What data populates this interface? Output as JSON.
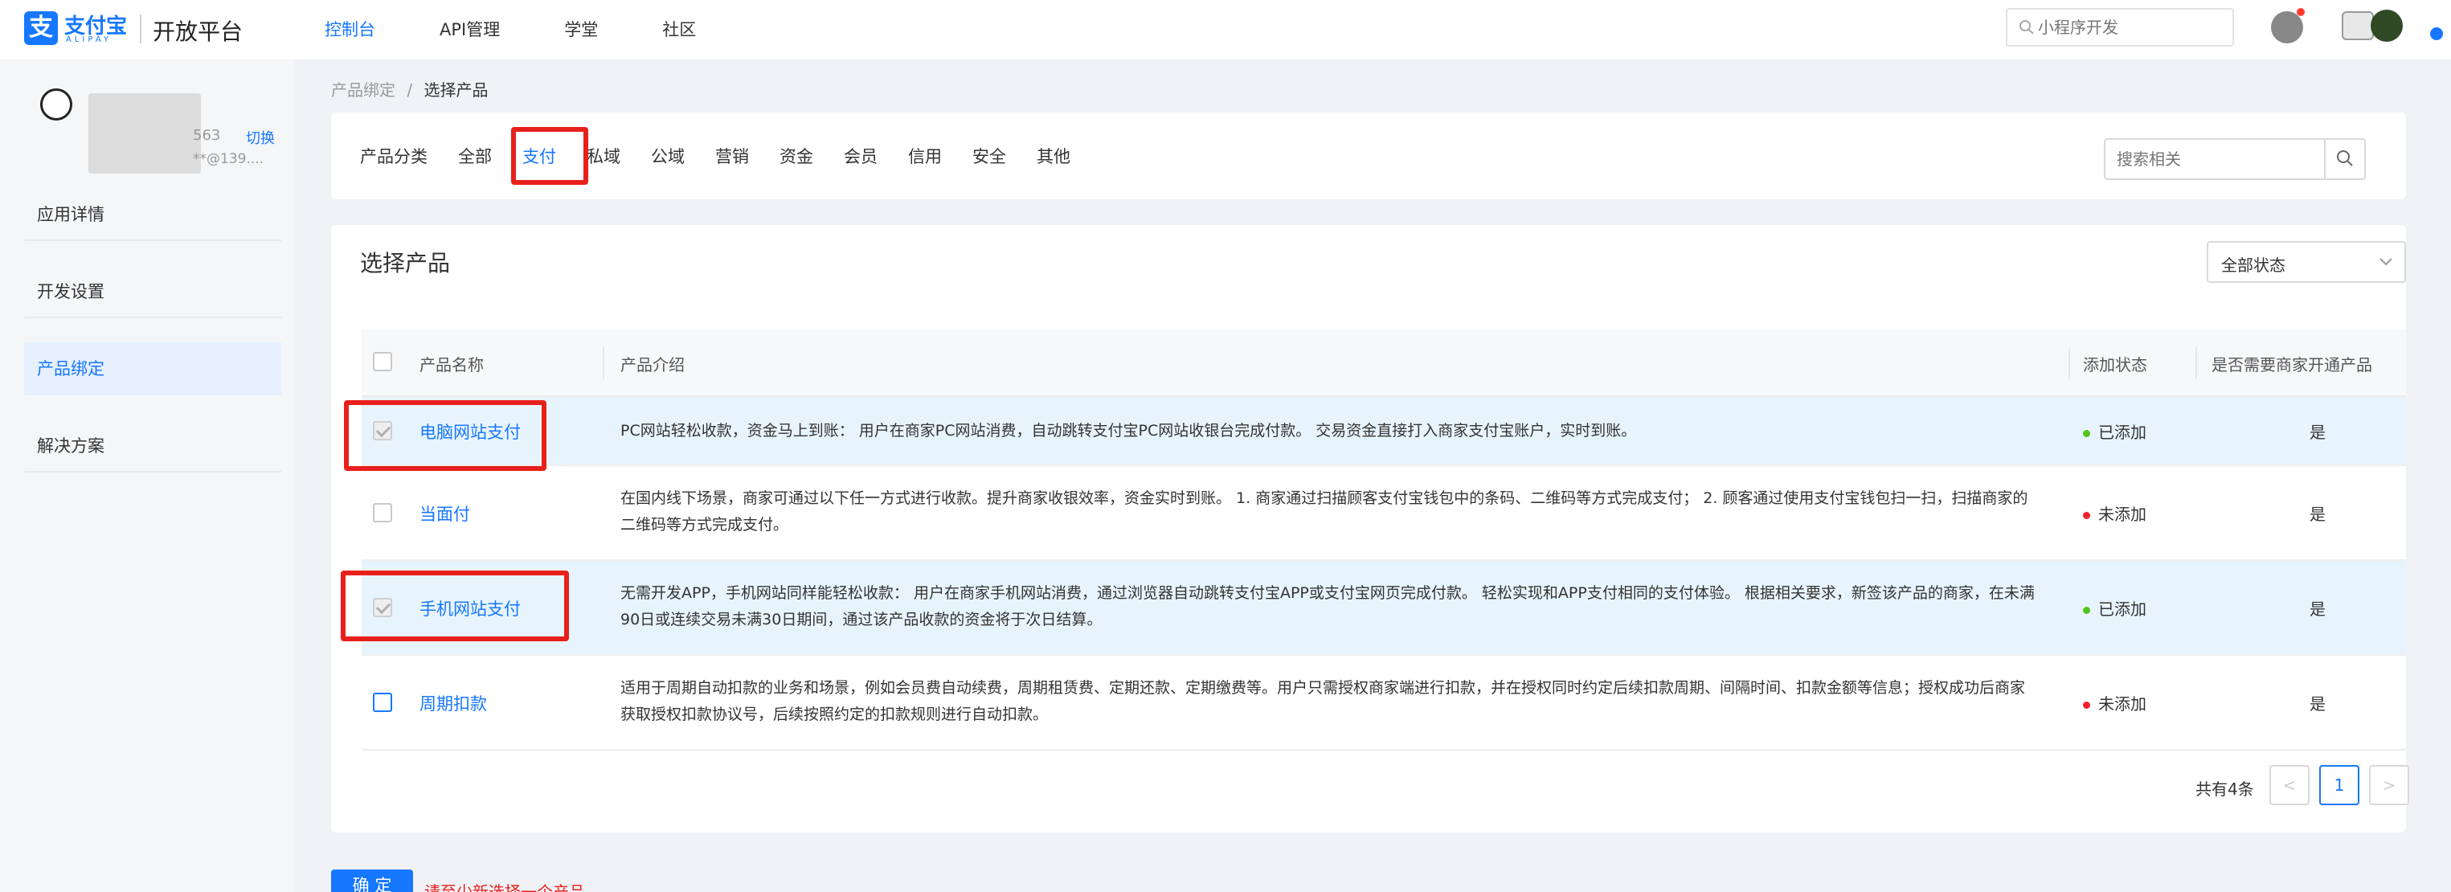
{
  "header": {
    "logo_cn": "支付宝",
    "logo_en": "ALIPAY",
    "platform": "开放平台",
    "nav": [
      {
        "label": "控制台",
        "active": true
      },
      {
        "label": "API管理",
        "active": false
      },
      {
        "label": "学堂",
        "active": false
      },
      {
        "label": "社区",
        "active": false
      }
    ],
    "search_placeholder": "小程序开发"
  },
  "sidebar": {
    "account_suffix": "563",
    "switch_label": "切换",
    "email": "**@139....",
    "items": [
      {
        "label": "应用详情",
        "active": false
      },
      {
        "label": "开发设置",
        "active": false
      },
      {
        "label": "产品绑定",
        "active": true
      },
      {
        "label": "解决方案",
        "active": false
      }
    ]
  },
  "breadcrumb": {
    "parent": "产品绑定",
    "sep": "/",
    "current": "选择产品"
  },
  "filters": {
    "label": "产品分类",
    "tabs": [
      "全部",
      "支付",
      "私域",
      "公域",
      "营销",
      "资金",
      "会员",
      "信用",
      "安全",
      "其他"
    ],
    "active_tab": "支付",
    "search_placeholder": "搜索相关"
  },
  "main": {
    "title": "选择产品",
    "status_select": "全部状态",
    "columns": {
      "name": "产品名称",
      "intro": "产品介绍",
      "status": "添加状态",
      "need": "是否需要商家开通产品"
    },
    "rows": [
      {
        "name": "电脑网站支付",
        "desc": "PC网站轻松收款，资金马上到账： 用户在商家PC网站消费，自动跳转支付宝PC网站收银台完成付款。 交易资金直接打入商家支付宝账户，实时到账。",
        "status": "已添加",
        "need": "是",
        "checked": true,
        "status_color": "#52c41a"
      },
      {
        "name": "当面付",
        "desc": "在国内线下场景，商家可通过以下任一方式进行收款。提升商家收银效率，资金实时到账。 1. 商家通过扫描顾客支付宝钱包中的条码、二维码等方式完成支付； 2. 顾客通过使用支付宝钱包扫一扫，扫描商家的二维码等方式完成支付。",
        "status": "未添加",
        "need": "是",
        "checked": false,
        "status_color": "#f5222d"
      },
      {
        "name": "手机网站支付",
        "desc": "无需开发APP，手机网站同样能轻松收款： 用户在商家手机网站消费，通过浏览器自动跳转支付宝APP或支付宝网页完成付款。 轻松实现和APP支付相同的支付体验。 根据相关要求，新签该产品的商家，在未满90日或连续交易未满30日期间，通过该产品收款的资金将于次日结算。",
        "status": "已添加",
        "need": "是",
        "checked": true,
        "status_color": "#52c41a"
      },
      {
        "name": "周期扣款",
        "desc": "适用于周期自动扣款的业务和场景，例如会员费自动续费，周期租赁费、定期还款、定期缴费等。用户只需授权商家端进行扣款，并在授权同时约定后续扣款周期、间隔时间、扣款金额等信息；授权成功后商家获取授权扣款协议号，后续按照约定的扣款规则进行自动扣款。",
        "status": "未添加",
        "need": "是",
        "checked": false,
        "status_color": "#f5222d"
      }
    ],
    "pagination": {
      "total": "共有4条",
      "prev": "<",
      "page": "1",
      "next": ">"
    }
  },
  "footer": {
    "confirm": "确 定",
    "hint": "请至少新选择一个产品"
  },
  "colors": {
    "accent": "#1677ff",
    "highlight": "#e8201c"
  }
}
